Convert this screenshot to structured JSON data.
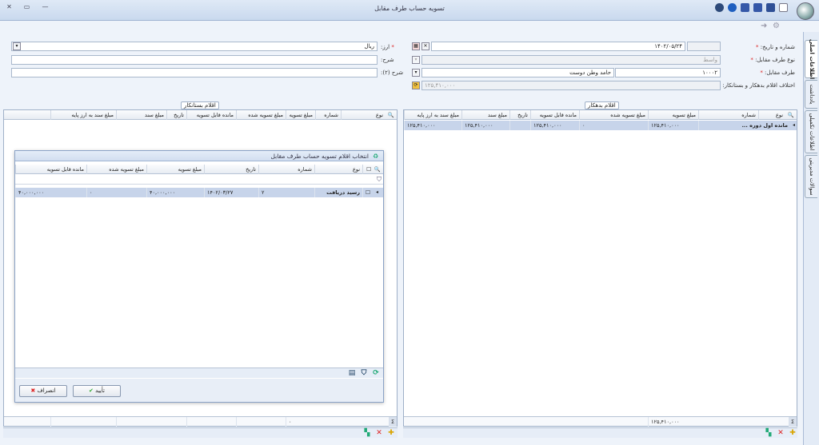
{
  "window": {
    "title": "تسویه حساب طرف مقابل"
  },
  "side_tabs": [
    "اطلاعات اصلی",
    "یادداشت",
    "اطلاعات تکمیلی",
    "سوالات مدیریتی"
  ],
  "form": {
    "number_date_label": "شماره و تاریخ:",
    "date_value": "۱۴۰۲/۰۵/۲۴",
    "party_type_label": "نوع طرف مقابل:",
    "party_type_value": "واسط",
    "party_label": "طرف مقابل:",
    "party_code": "۱۰۰۰۲",
    "party_name": "حامد وطن دوست",
    "diff_label": "اختلاف اقلام بدهکار و بستانکار:",
    "diff_value": "۱۲۵,۴۱۰,۰۰۰",
    "currency_label": "ارز:",
    "currency_value": "ریال",
    "desc_label": "شرح:",
    "desc2_label": "شرح (۲):"
  },
  "debit_panel": {
    "caption": "اقلام بدهکار",
    "columns": [
      "نوع",
      "شماره",
      "مبلغ تسویه",
      "مبلغ تسویه شده",
      "مانده قابل تسویه",
      "تاریخ",
      "مبلغ سند",
      "مبلغ سند به ارز پایه"
    ],
    "rows": [
      {
        "type": "مانده اول دوره ...",
        "number": "",
        "settle": "۱۲۵,۴۱۰,۰۰۰",
        "settled": "۰",
        "remaining": "۱۲۵,۴۱۰,۰۰۰",
        "date": "",
        "doc_amount": "۱۲۵,۴۱۰,۰۰۰",
        "doc_base": "۱۲۵,۴۱۰,۰۰۰"
      }
    ],
    "footer_total": "۱۲۵,۴۱۰,۰۰۰"
  },
  "credit_panel": {
    "caption": "اقلام بستانکار",
    "columns": [
      "نوع",
      "شماره",
      "مبلغ تسویه",
      "مبلغ تسویه شده",
      "مانده قابل تسویه",
      "تاریخ",
      "مبلغ سند",
      "مبلغ سند به ارز پایه"
    ],
    "footer_total": "۰"
  },
  "dialog": {
    "title": "انتخاب اقلام تسویه حساب طرف مقابل",
    "columns": [
      "نوع",
      "شماره",
      "تاریخ",
      "مبلغ تسویه",
      "مبلغ تسویه شده",
      "مانده قابل تسویه"
    ],
    "rows": [
      {
        "type": "رسید دریافت",
        "number": "۲",
        "date": "۱۴۰۲/۰۳/۲۷",
        "settle": "۴۰,۰۰۰,۰۰۰",
        "settled": "۰",
        "remaining": "۴۰,۰۰۰,۰۰۰"
      }
    ],
    "ok_label": "تأیید",
    "cancel_label": "انصراف"
  }
}
